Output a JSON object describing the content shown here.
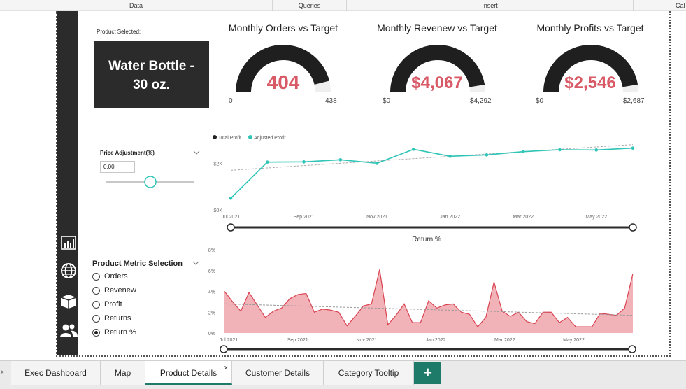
{
  "ribbon": {
    "data": "Data",
    "queries": "Queries",
    "insert": "Insert",
    "cal": "Cal"
  },
  "product": {
    "label": "Product Selected:",
    "name_line1": "Water Bottle -",
    "name_line2": "30 oz."
  },
  "gauges": [
    {
      "title": "Monthly Orders vs Target",
      "value": "404",
      "min": "0",
      "max": "438",
      "fraction": 0.922
    },
    {
      "title": "Monthly Revenew vs Target",
      "value": "$4,067",
      "min": "$0",
      "max": "$4,292",
      "fraction": 0.948
    },
    {
      "title": "Monthly Profits vs Target",
      "value": "$2,546",
      "min": "$0",
      "max": "$2,687",
      "fraction": 0.947
    }
  ],
  "price_adjustment": {
    "title": "Price Adjustment(%)",
    "value": "0.00"
  },
  "metric_selection": {
    "title": "Product Metric Selection",
    "options": [
      "Orders",
      "Revenew",
      "Profit",
      "Returns",
      "Return %"
    ],
    "selected": "Return %"
  },
  "colors": {
    "accent": "#1e7b6a",
    "gauge_value": "#d85a66",
    "teal": "#2ec4b6",
    "sidebar": "#2b2b2b",
    "area_fill": "#f2b3b8",
    "area_line": "#d94452"
  },
  "chart_data": [
    {
      "type": "line",
      "legend": [
        "Total Profit",
        "Adjusted Profit"
      ],
      "legend_position": "top-left",
      "x_ticks": [
        "Jul 2021",
        "Sep 2021",
        "Nov 2021",
        "Jan 2022",
        "Mar 2022",
        "May 2022"
      ],
      "y_ticks": [
        "$0K",
        "$2K"
      ],
      "ylim": [
        0,
        3000
      ],
      "series": [
        {
          "name": "Adjusted Profit",
          "x": [
            "2021-07",
            "2021-08",
            "2021-09",
            "2021-10",
            "2021-11",
            "2021-12",
            "2022-01",
            "2022-02",
            "2022-03",
            "2022-04",
            "2022-05",
            "2022-06"
          ],
          "values": [
            500,
            2050,
            2060,
            2150,
            2000,
            2600,
            2300,
            2360,
            2500,
            2580,
            2570,
            2650
          ]
        }
      ],
      "trend": [
        1700,
        2800
      ]
    },
    {
      "type": "area",
      "title": "Return %",
      "x_ticks": [
        "Jul 2021",
        "Sep 2021",
        "Nov 2021",
        "Jan 2022",
        "Mar 2022",
        "May 2022"
      ],
      "y_ticks": [
        "0%",
        "2%",
        "4%",
        "6%",
        "8%"
      ],
      "ylim": [
        0,
        8
      ],
      "values": [
        4.0,
        3.0,
        2.1,
        3.9,
        2.7,
        1.5,
        2.1,
        2.4,
        3.3,
        3.7,
        3.8,
        2.0,
        2.3,
        2.2,
        2.0,
        0.7,
        1.6,
        2.6,
        2.8,
        6.1,
        0.8,
        1.7,
        2.8,
        1.0,
        1.0,
        3.1,
        2.4,
        2.7,
        2.8,
        2.0,
        1.8,
        0.6,
        1.5,
        4.9,
        2.1,
        1.6,
        2.0,
        1.1,
        0.9,
        2.0,
        2.0,
        1.0,
        1.5,
        0.6,
        0.6,
        0.6,
        1.9,
        1.8,
        1.7,
        2.4,
        5.7
      ],
      "trend": [
        2.8,
        1.7
      ]
    }
  ],
  "tabs": [
    "Exec Dashboard",
    "Map",
    "Product Details",
    "Customer Details",
    "Category Tooltip"
  ],
  "active_tab": "Product Details",
  "tab_close": "x",
  "add_tab": "+",
  "nav_prev": "▸"
}
